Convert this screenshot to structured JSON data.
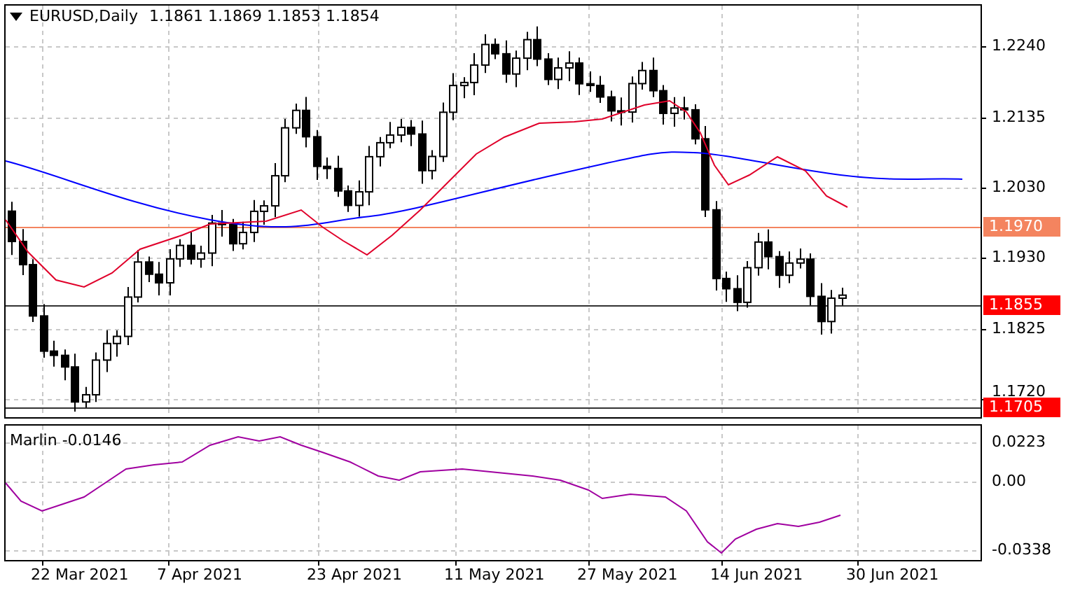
{
  "chart_header": {
    "symbol_timeframe": "EURUSD,Daily",
    "ohlc": "1.1861 1.1869 1.1853 1.1854"
  },
  "price_axis": {
    "labels": [
      "1.2240",
      "1.2135",
      "1.2030",
      "1.1930",
      "1.1825",
      "1.1720"
    ]
  },
  "price_tags": [
    {
      "text": "1.1970",
      "color": "#f4845f"
    },
    {
      "text": "1.1855",
      "color": "#ff0000"
    },
    {
      "text": "1.1705",
      "color": "#ff0000"
    }
  ],
  "indicator": {
    "title": "Marlin -0.0146",
    "axis_labels": [
      "0.0223",
      "0.00",
      "-0.0338"
    ]
  },
  "date_axis": {
    "labels": [
      "22 Mar 2021",
      "7 Apr 2021",
      "23 Apr 2021",
      "11 May 2021",
      "27 May 2021",
      "14 Jun 2021",
      "30 Jun 2021"
    ]
  }
}
